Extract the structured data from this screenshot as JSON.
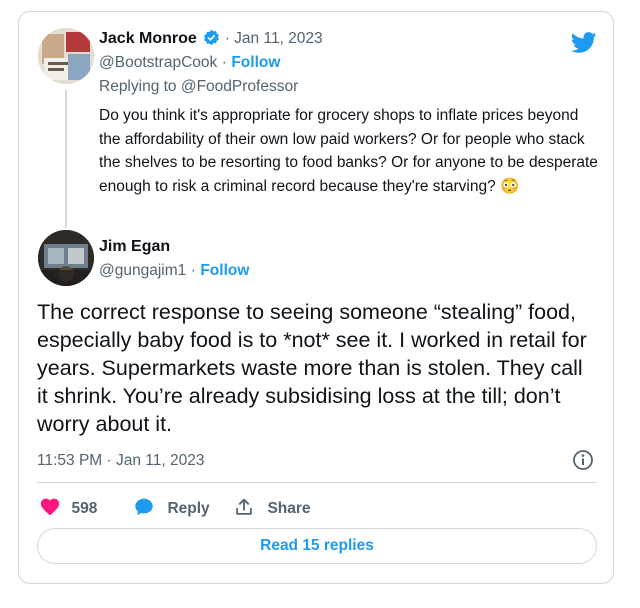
{
  "colors": {
    "accent": "#1d9bf0",
    "like": "#f91880",
    "text": "#0f1419",
    "muted": "#536471",
    "border": "#cfd9de"
  },
  "quoted_tweet": {
    "author_name": "Jack Monroe",
    "verified_icon": "verified-badge-icon",
    "date": "· Jan 11, 2023",
    "handle": "@BootstrapCook",
    "dot": "·",
    "follow_label": "Follow",
    "replying_to": "Replying to @FoodProfessor",
    "text": "Do you think it's appropriate for grocery shops to inflate prices beyond the affordability of their own low paid workers? Or for people who stack the shelves to be resorting to food banks? Or for anyone to be desperate enough to risk a criminal record because they're starving?",
    "emoji": "😳"
  },
  "main_tweet": {
    "author_name": "Jim Egan",
    "handle": "@gungajim1",
    "dot": "·",
    "follow_label": "Follow",
    "text": "The correct response to seeing someone “stealing” food, especially baby food is to *not* see it. I worked in retail for years. Supermarkets waste more than is stolen. They call it shrink. You’re already subsidising loss at the till; don’t worry about it.",
    "timestamp": "11:53 PM · Jan 11, 2023"
  },
  "actions": {
    "like_count": "598",
    "reply_label": "Reply",
    "share_label": "Share"
  },
  "replies_button": "Read 15 replies",
  "icons": {
    "brand": "twitter-bird-icon",
    "info": "info-icon",
    "like": "heart-icon",
    "reply": "reply-bubble-icon",
    "share": "share-icon"
  }
}
